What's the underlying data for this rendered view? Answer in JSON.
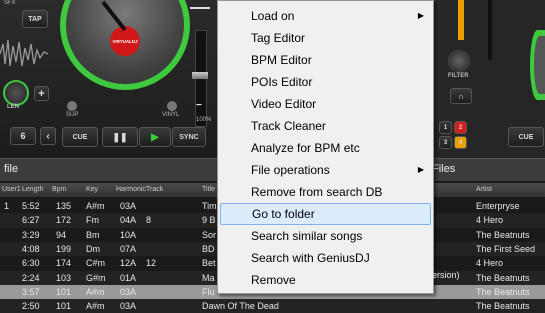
{
  "deck": {
    "sfx_label": "SFX",
    "tap_label": "TAP",
    "len_label": "LEN",
    "sup_left": "SUP",
    "sup_mid": "SUP",
    "vinyl_label": "VINYL",
    "filter_label": "FILTER",
    "zoom_label": "100%",
    "logo_text": "VIRTUALDJ",
    "beat_count": "6",
    "cue_label": "CUE",
    "sync_label": "SYNC",
    "cue_right": "CUE",
    "pads": [
      "1",
      "2",
      "3",
      "4"
    ]
  },
  "browser": {
    "left_title": "file",
    "right_title": "Files",
    "columns": {
      "user": "User1",
      "length": "Length",
      "bpm": "Bpm",
      "key": "Key",
      "harmonic": "Harmonic",
      "track": "Track",
      "title": "Title",
      "artist": "Artist"
    },
    "rows": [
      {
        "user": "1",
        "length": "5:52",
        "bpm": "135",
        "key": "A#m",
        "harmonic": "03A",
        "track": "",
        "title": "Tim",
        "artist": "Enterpryse"
      },
      {
        "user": "",
        "length": "6:27",
        "bpm": "172",
        "key": "Fm",
        "harmonic": "04A",
        "track": "8",
        "title": "9 B",
        "artist": "4 Hero"
      },
      {
        "user": "",
        "length": "3:29",
        "bpm": "94",
        "key": "Bm",
        "harmonic": "10A",
        "track": "",
        "title": "Sor",
        "artist": "The Beatnuts"
      },
      {
        "user": "",
        "length": "4:08",
        "bpm": "199",
        "key": "Dm",
        "harmonic": "07A",
        "track": "",
        "title": "BD",
        "artist": "The First Seed"
      },
      {
        "user": "",
        "length": "6:30",
        "bpm": "174",
        "key": "C#m",
        "harmonic": "12A",
        "track": "12",
        "title": "Bet",
        "artist": "4 Hero"
      },
      {
        "user": "",
        "length": "2:24",
        "bpm": "103",
        "key": "G#m",
        "harmonic": "01A",
        "track": "",
        "title": "Ma",
        "artist": "The Beatnuts"
      },
      {
        "user": "",
        "length": "3:57",
        "bpm": "101",
        "key": "A#m",
        "harmonic": "03A",
        "track": "",
        "title": "Flu",
        "artist": "The Beatnuts"
      },
      {
        "user": "",
        "length": "2:50",
        "bpm": "101",
        "key": "A#m",
        "harmonic": "03A",
        "track": "",
        "title": "Dawn Of The Dead",
        "artist": "The Beatnuts"
      }
    ],
    "version_fragment": "ersion)"
  },
  "context_menu": {
    "items": [
      {
        "label": "Load on",
        "submenu": true
      },
      {
        "label": "Tag Editor",
        "submenu": false
      },
      {
        "label": "BPM Editor",
        "submenu": false
      },
      {
        "label": "POIs Editor",
        "submenu": false
      },
      {
        "label": "Video Editor",
        "submenu": false
      },
      {
        "label": "Track Cleaner",
        "submenu": false
      },
      {
        "label": "Analyze for BPM etc",
        "submenu": false
      },
      {
        "label": "File operations",
        "submenu": true
      },
      {
        "label": "Remove from search DB",
        "submenu": false
      },
      {
        "label": "Go to folder",
        "submenu": false
      },
      {
        "label": "Search similar songs",
        "submenu": false
      },
      {
        "label": "Search with GeniusDJ",
        "submenu": false
      },
      {
        "label": "Remove",
        "submenu": false
      }
    ],
    "highlighted": "Go to folder",
    "arrow_glyph": "▶"
  },
  "colors": {
    "accent_green": "#3ec93e",
    "logo_red": "#d01818",
    "highlight": "#dcecfc",
    "orange_pad": "#e8a000",
    "red_pad": "#d02020"
  }
}
